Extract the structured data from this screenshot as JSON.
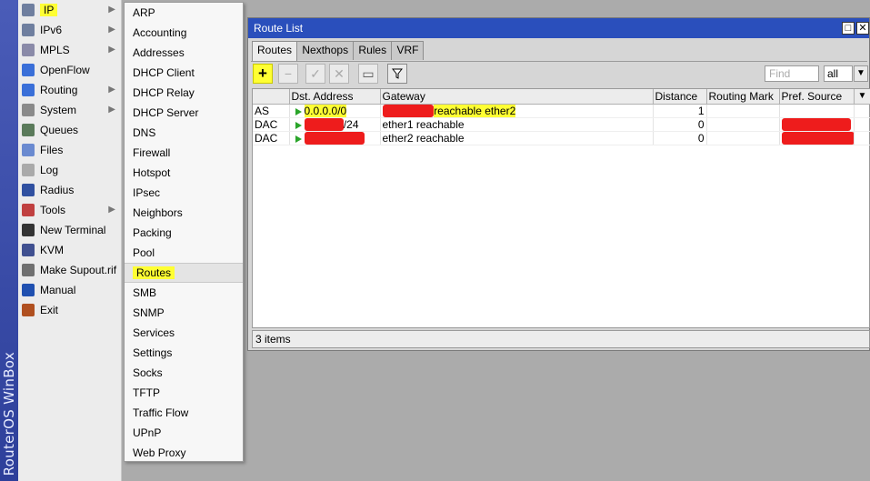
{
  "brand": "RouterOS WinBox",
  "main_menu": [
    {
      "label": "IP",
      "icon": "ip-icon",
      "arrow": true,
      "highlight": true
    },
    {
      "label": "IPv6",
      "icon": "ipv6-icon",
      "arrow": true
    },
    {
      "label": "MPLS",
      "icon": "mpls-icon",
      "arrow": true
    },
    {
      "label": "OpenFlow",
      "icon": "openflow-icon"
    },
    {
      "label": "Routing",
      "icon": "routing-icon",
      "arrow": true
    },
    {
      "label": "System",
      "icon": "system-gear-icon",
      "arrow": true
    },
    {
      "label": "Queues",
      "icon": "queues-icon"
    },
    {
      "label": "Files",
      "icon": "files-icon"
    },
    {
      "label": "Log",
      "icon": "log-icon"
    },
    {
      "label": "Radius",
      "icon": "radius-icon"
    },
    {
      "label": "Tools",
      "icon": "tools-icon",
      "arrow": true
    },
    {
      "label": "New Terminal",
      "icon": "terminal-icon"
    },
    {
      "label": "KVM",
      "icon": "kvm-icon"
    },
    {
      "label": "Make Supout.rif",
      "icon": "supout-icon"
    },
    {
      "label": "Manual",
      "icon": "manual-icon"
    },
    {
      "label": "Exit",
      "icon": "exit-icon"
    }
  ],
  "ip_submenu": [
    "ARP",
    "Accounting",
    "Addresses",
    "DHCP Client",
    "DHCP Relay",
    "DHCP Server",
    "DNS",
    "Firewall",
    "Hotspot",
    "IPsec",
    "Neighbors",
    "Packing",
    "Pool",
    "Routes",
    "SMB",
    "SNMP",
    "Services",
    "Settings",
    "Socks",
    "TFTP",
    "Traffic Flow",
    "UPnP",
    "Web Proxy"
  ],
  "route_window": {
    "title": "Route List",
    "restore_glyph": "□",
    "close_glyph": "✕",
    "tabs": [
      "Routes",
      "Nexthops",
      "Rules",
      "VRF"
    ],
    "find_placeholder": "Find",
    "filter_select": "all",
    "columns": [
      "",
      "Dst. Address",
      "Gateway",
      "Distance",
      "Routing Mark",
      "Pref. Source"
    ],
    "rows": [
      {
        "type": "AS",
        "dst": "0.0.0.0/0",
        "gateway": "reachable ether2",
        "distance": "1",
        "mark": "",
        "pref_source": ""
      },
      {
        "type": "DAC",
        "dst": "/24",
        "gateway": "ether1 reachable",
        "distance": "0",
        "mark": "",
        "pref_source": ""
      },
      {
        "type": "DAC",
        "dst": "",
        "gateway": "ether2 reachable",
        "distance": "0",
        "mark": "",
        "pref_source": ""
      }
    ],
    "status": "3 items"
  },
  "colors": {
    "highlight": "#ffff33",
    "titlebar": "#2a4fbc",
    "redaction": "#ee1c1c",
    "flag": "#2aa52a"
  }
}
